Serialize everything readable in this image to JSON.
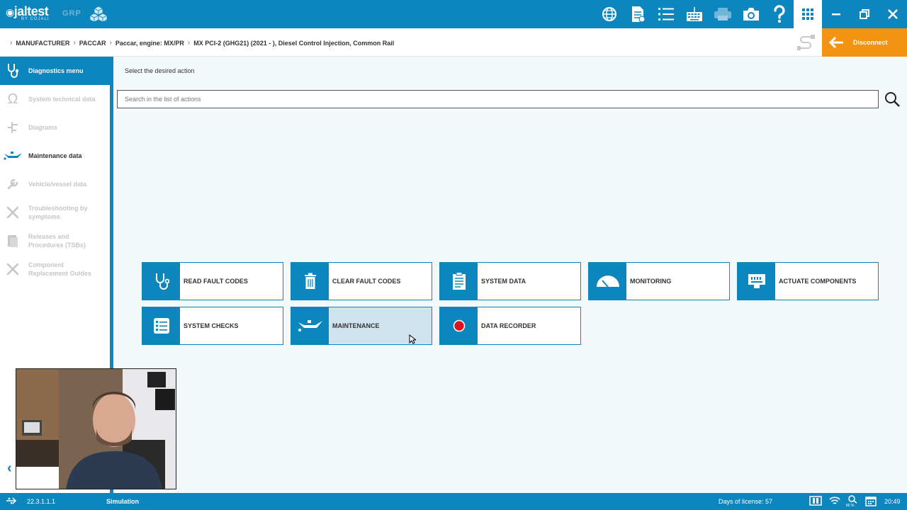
{
  "app": {
    "logo_text": "jaltest",
    "logo_sub": "BY COJALI",
    "grp_label": "GRP"
  },
  "toolbar": {
    "icons": [
      "globe-icon",
      "document-icon",
      "list-icon",
      "keyboard-icon",
      "printer-icon",
      "camera-icon",
      "help-icon",
      "apps-grid-icon",
      "minimize-icon",
      "restore-icon",
      "close-icon"
    ]
  },
  "breadcrumb": {
    "items": [
      "MANUFACTURER",
      "PACCAR",
      "Paccar, engine: MX/PR",
      "MX PCI-2 (GHG21) (2021 - ), Diesel Control Injection, Common Rail"
    ]
  },
  "disconnect_label": "Disconnect",
  "sidebar": {
    "header": "Diagnostics menu",
    "items": [
      {
        "label": "System technical data",
        "enabled": false
      },
      {
        "label": "Diagrams",
        "enabled": false
      },
      {
        "label": "Maintenance data",
        "enabled": true
      },
      {
        "label": "Vehicle/vessel data",
        "enabled": false
      },
      {
        "label_lines": [
          "Troubleshooting by",
          "symptoms"
        ],
        "enabled": false
      },
      {
        "label_lines": [
          "Releases and",
          "Procedures (TSBs)"
        ],
        "enabled": false
      },
      {
        "label_lines": [
          "Component",
          "Replacement Guides"
        ],
        "enabled": false
      }
    ]
  },
  "main": {
    "prompt": "Select the desired action",
    "search_placeholder": "Search in the list of actions",
    "actions": [
      {
        "label": "READ FAULT CODES",
        "icon": "stethoscope-icon"
      },
      {
        "label": "CLEAR FAULT CODES",
        "icon": "trash-icon"
      },
      {
        "label": "SYSTEM DATA",
        "icon": "clipboard-icon"
      },
      {
        "label": "MONITORING",
        "icon": "gauge-icon"
      },
      {
        "label": "ACTUATE COMPONENTS",
        "icon": "connector-icon"
      },
      {
        "label": "SYSTEM CHECKS",
        "icon": "checklist-icon"
      },
      {
        "label": "MAINTENANCE",
        "icon": "oil-can-icon",
        "selected": true
      },
      {
        "label": "DATA RECORDER",
        "icon": "record-icon"
      }
    ]
  },
  "status": {
    "version": "22.3.1.1.1",
    "mode": "Simulation",
    "license": "Days of license: 57",
    "battery_pct": "80 %",
    "time": "20:49"
  },
  "colors": {
    "primary": "#0d86bd",
    "accent": "#f39313",
    "background": "#f3f9fb",
    "selected_tile": "#cfe3ef"
  }
}
